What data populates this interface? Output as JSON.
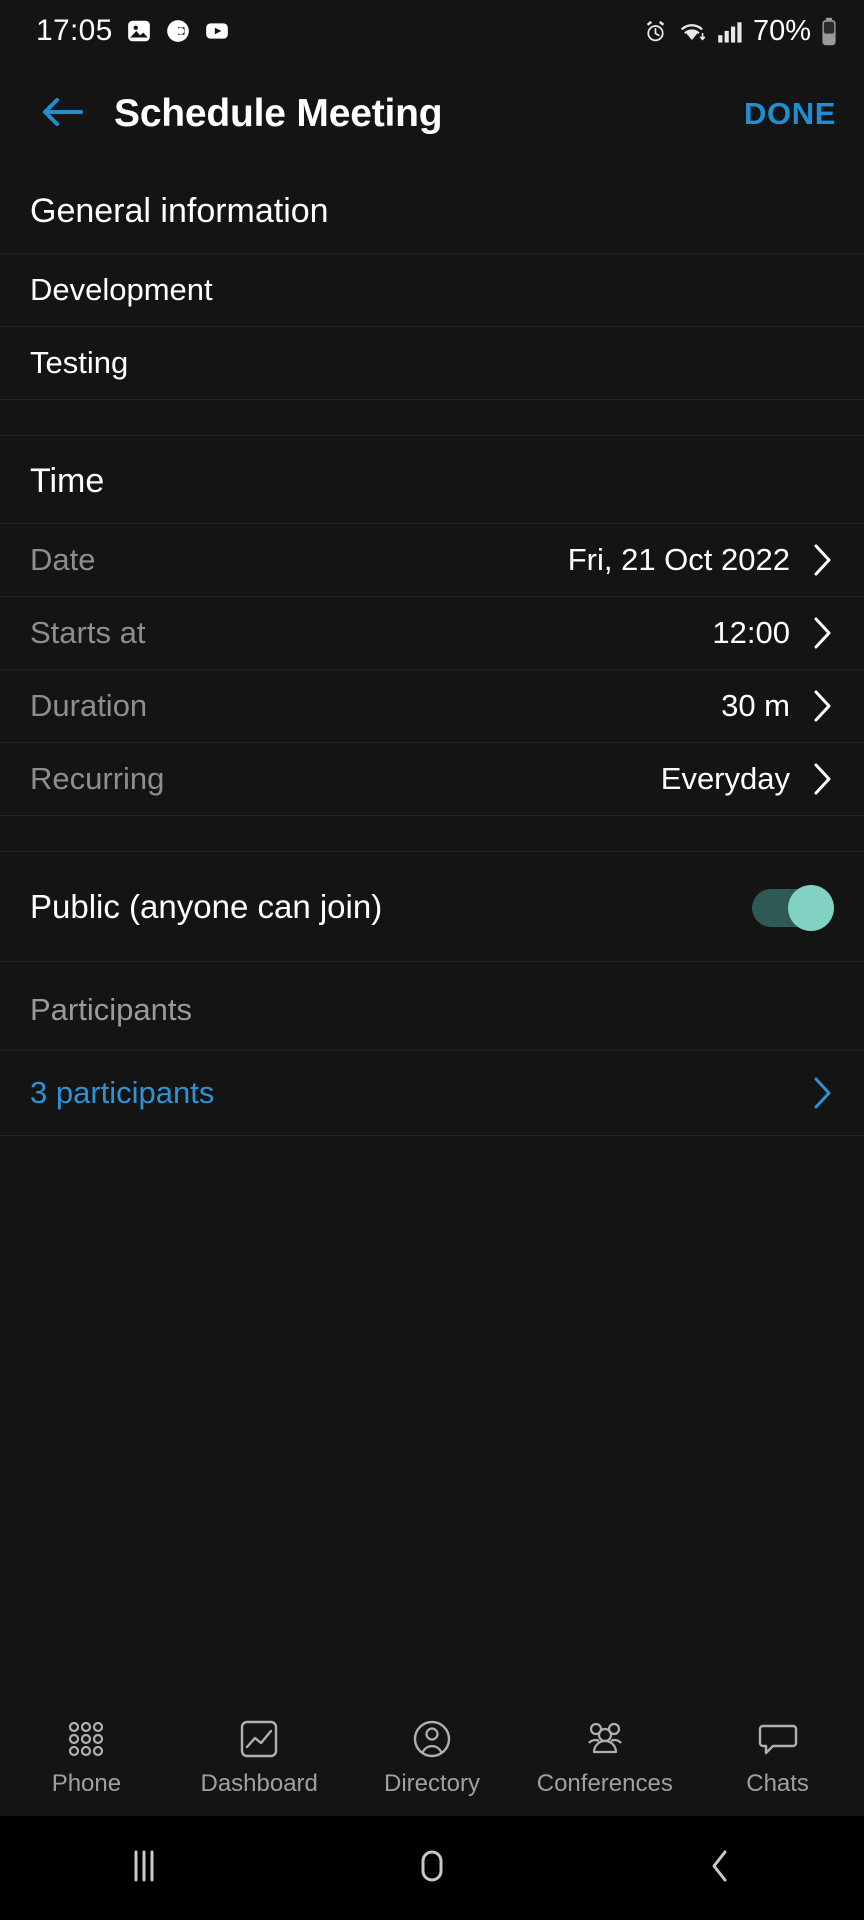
{
  "status_bar": {
    "time": "17:05",
    "battery_text": "70%",
    "left_icons": [
      "gallery-icon",
      "g-app-icon",
      "youtube-icon"
    ],
    "right_icons": [
      "alarm-icon",
      "wifi-icon",
      "signal-icon",
      "battery-icon"
    ]
  },
  "header": {
    "back_icon": "arrow-left-icon",
    "title": "Schedule Meeting",
    "done_label": "DONE",
    "accent_color": "#1f8fd0"
  },
  "general": {
    "section_title": "General information",
    "rows": [
      {
        "label": "Development"
      },
      {
        "label": "Testing"
      }
    ]
  },
  "time": {
    "section_title": "Time",
    "rows": [
      {
        "label": "Date",
        "value": "Fri, 21 Oct 2022"
      },
      {
        "label": "Starts at",
        "value": "12:00"
      },
      {
        "label": "Duration",
        "value": "30 m"
      },
      {
        "label": "Recurring",
        "value": "Everyday"
      }
    ]
  },
  "public": {
    "label": "Public (anyone can join)",
    "toggle_on": true,
    "track_color": "#2f5954",
    "thumb_color": "#82d2c4"
  },
  "participants": {
    "section_title": "Participants",
    "link_label": "3 participants",
    "link_color": "#2d93d6"
  },
  "tabbar": {
    "tabs": [
      {
        "label": "Phone",
        "icon": "dialpad-grid-icon"
      },
      {
        "label": "Dashboard",
        "icon": "chart-square-icon"
      },
      {
        "label": "Directory",
        "icon": "person-circle-icon"
      },
      {
        "label": "Conferences",
        "icon": "people-group-icon"
      },
      {
        "label": "Chats",
        "icon": "speech-bubble-icon"
      }
    ]
  },
  "navbar": {
    "recents_icon": "recents-bars-icon",
    "home_icon": "home-square-icon",
    "back_icon": "back-chevron-icon"
  }
}
